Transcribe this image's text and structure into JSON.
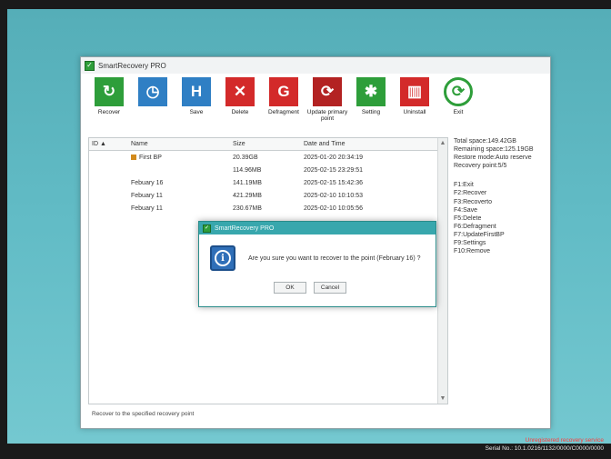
{
  "window": {
    "title": "SmartRecovery PRO"
  },
  "toolbar": {
    "buttons": [
      {
        "label": "Recover",
        "icon": "recover-icon",
        "glyph": "↻"
      },
      {
        "label": "",
        "icon": "clock-icon",
        "glyph": "◷"
      },
      {
        "label": "Save",
        "icon": "save-icon",
        "glyph": "H"
      },
      {
        "label": "Delete",
        "icon": "delete-icon",
        "glyph": "✕"
      },
      {
        "label": "Defragment",
        "icon": "defragment-icon",
        "glyph": "G"
      },
      {
        "label": "Update primary point",
        "icon": "update-icon",
        "glyph": "⟳"
      },
      {
        "label": "Setting",
        "icon": "setting-icon",
        "glyph": "✱"
      },
      {
        "label": "Uninstall",
        "icon": "uninstall-icon",
        "glyph": "▥"
      },
      {
        "label": "Exit",
        "icon": "exit-icon",
        "glyph": "⟳"
      }
    ]
  },
  "list": {
    "headers": {
      "id": "ID ▲",
      "name": "Name",
      "size": "Size",
      "date": "Date and Time"
    },
    "rows": [
      {
        "id": "",
        "name": "First BP",
        "size": "20.39GB",
        "date": "2025-01-20 20:34:19"
      },
      {
        "id": "",
        "name": "",
        "size": "114.96MB",
        "date": "2025-02-15 23:29:51"
      },
      {
        "id": "",
        "name": "Febuary 16",
        "size": "141.19MB",
        "date": "2025-02-15 15:42:36"
      },
      {
        "id": "",
        "name": "Febuary 11",
        "size": "421.29MB",
        "date": "2025-02-10 10:10:53"
      },
      {
        "id": "",
        "name": "Febuary 11",
        "size": "230.67MB",
        "date": "2025-02-10 10:05:56"
      }
    ]
  },
  "side_panel": {
    "total_space": "Total space:149.42GB",
    "remaining_space": "Remaining space:125.19GB",
    "restore_mode": "Restore mode:Auto reserve",
    "recovery_point": "Recovery point:5/5",
    "shortcuts": [
      "F1:Exit",
      "F2:Recover",
      "F3:Recoverto",
      "F4:Save",
      "F5:Delete",
      "F6:Defragment",
      "F7:UpdateFirstBP",
      "F9:Settings",
      "F10:Remove"
    ]
  },
  "statusbar": {
    "text": "Recover to the specified recovery point"
  },
  "dialog": {
    "title": "SmartRecovery PRO",
    "message": "Are you sure you want to recover to the point (February 16) ?",
    "ok_label": "OK",
    "cancel_label": "Cancel"
  },
  "watermark": {
    "line1": "Unregistered recovery service",
    "line2": "Serial No.: 10.1.0216/1132/0000/C0000/0000"
  }
}
